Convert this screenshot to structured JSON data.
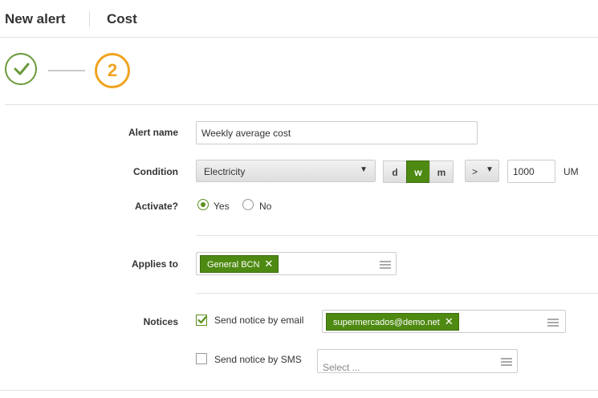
{
  "header": {
    "title": "New alert",
    "subtitle": "Cost"
  },
  "steps": {
    "current_number": "2",
    "completed_icon": "check-icon"
  },
  "form": {
    "alert_name_label": "Alert name",
    "alert_name_value": "Weekly average cost",
    "condition_label": "Condition",
    "condition_value": "Electricity",
    "period_options": [
      "d",
      "w",
      "m"
    ],
    "period_selected": "w",
    "operator_value": ">",
    "threshold_value": "1000",
    "unit": "UM",
    "activate_label": "Activate?",
    "activate_yes": "Yes",
    "activate_no": "No",
    "activate_selected": "Yes",
    "applies_label": "Applies to",
    "applies_tag": "General BCN",
    "notices_label": "Notices",
    "email_label": "Send notice by email",
    "email_checked": true,
    "email_tag": "supermercados@demo.net",
    "sms_label": "Send notice by SMS",
    "sms_checked": false,
    "sms_placeholder": "Select ..."
  },
  "colors": {
    "accent_green": "#4e8a12",
    "step_orange": "#f0a31f",
    "done_green": "#6a9a3a"
  }
}
